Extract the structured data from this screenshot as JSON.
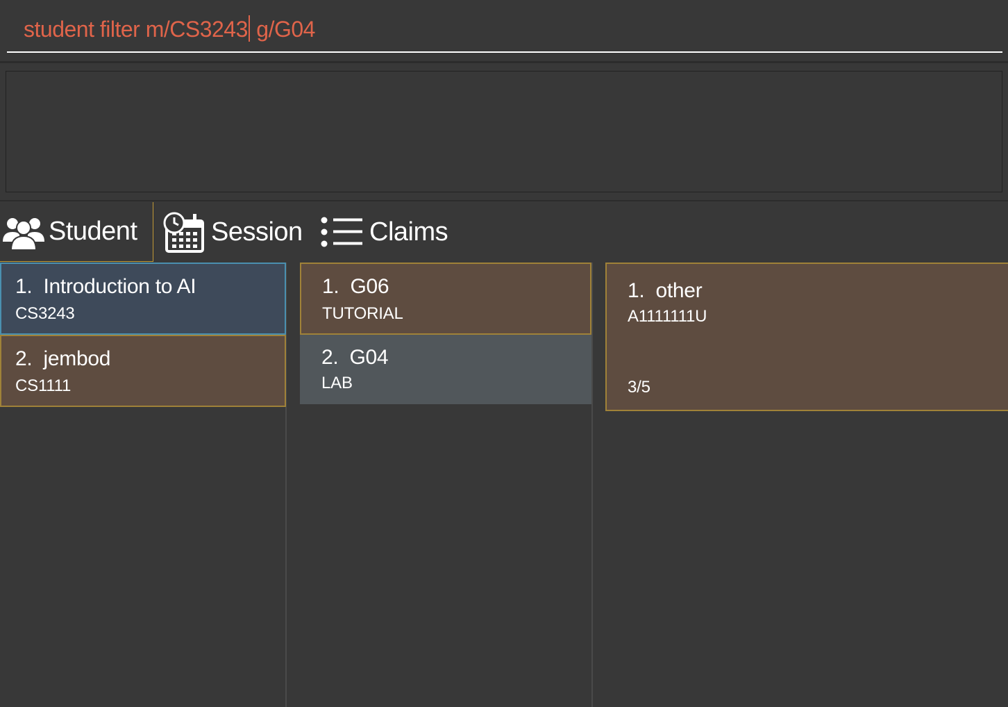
{
  "command": {
    "before_caret": "student filter m/CS3243",
    "after_caret": " g/G04"
  },
  "result": {
    "text": ""
  },
  "tabs": [
    {
      "label": "Student",
      "icon": "students-icon"
    },
    {
      "label": "Session",
      "icon": "calendar-clock-icon"
    },
    {
      "label": "Claims",
      "icon": "list-icon"
    }
  ],
  "modules": [
    {
      "index": "1.",
      "name": "Introduction to AI",
      "code": "CS3243",
      "selected": true
    },
    {
      "index": "2.",
      "name": "jembod",
      "code": "CS1111",
      "selected": false
    }
  ],
  "sessions": [
    {
      "index": "1.",
      "name": "G06",
      "type": "TUTORIAL",
      "selected": false
    },
    {
      "index": "2.",
      "name": "G04",
      "type": "LAB",
      "selected": true
    }
  ],
  "students": [
    {
      "index": "1.",
      "name": "other",
      "matric": "A1111111U",
      "count": "3/5"
    }
  ],
  "colors": {
    "background": "#383838",
    "command_text": "#e0644a",
    "card_brown": "#5e4c40",
    "card_border": "#a08238",
    "card_selected": "#3e4a5a",
    "card_grey": "#51575b"
  }
}
